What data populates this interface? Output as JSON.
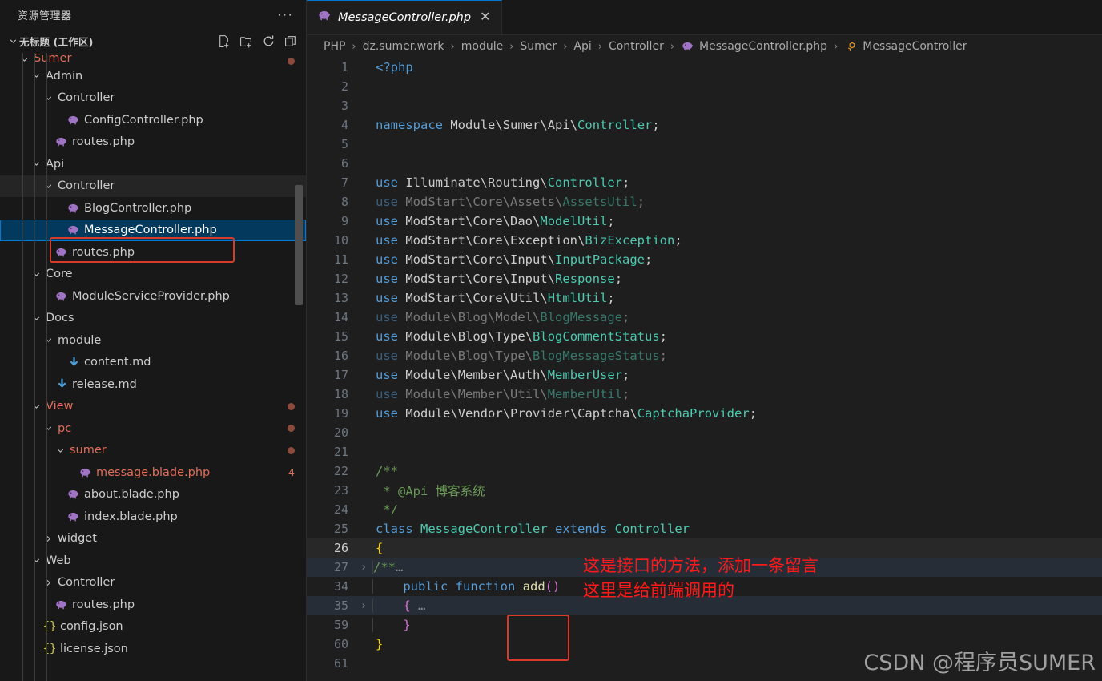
{
  "sidebar": {
    "title": "资源管理器",
    "more_label": "···",
    "workspace": "无标题 (工作区)",
    "actions": [
      {
        "name": "new-file-icon",
        "label": "新建文件"
      },
      {
        "name": "new-folder-icon",
        "label": "新建文件夹"
      },
      {
        "name": "refresh-icon",
        "label": "刷新资源管理器"
      },
      {
        "name": "collapse-all-icon",
        "label": "在资源管理器中折叠文件夹"
      }
    ],
    "tree": [
      {
        "label": "Sumer",
        "type": "folder",
        "depth": 2,
        "expanded": true,
        "color": "modred",
        "dot": true,
        "clipped": false
      },
      {
        "label": "Admin",
        "type": "folder",
        "depth": 3,
        "expanded": true,
        "color": "",
        "dot": false
      },
      {
        "label": "Controller",
        "type": "folder",
        "depth": 4,
        "expanded": true,
        "color": "",
        "dot": false
      },
      {
        "label": "ConfigController.php",
        "type": "php",
        "depth": 5,
        "color": "",
        "dot": false
      },
      {
        "label": "routes.php",
        "type": "php",
        "depth": 4,
        "color": "",
        "dot": false
      },
      {
        "label": "Api",
        "type": "folder",
        "depth": 3,
        "expanded": true,
        "color": "",
        "dot": false
      },
      {
        "label": "Controller",
        "type": "folder",
        "depth": 4,
        "expanded": true,
        "color": "",
        "dot": false,
        "highlighted": true
      },
      {
        "label": "BlogController.php",
        "type": "php",
        "depth": 5,
        "color": "",
        "dot": false
      },
      {
        "label": "MessageController.php",
        "type": "php",
        "depth": 5,
        "color": "",
        "dot": false,
        "selected": true
      },
      {
        "label": "routes.php",
        "type": "php",
        "depth": 4,
        "color": "",
        "dot": false
      },
      {
        "label": "Core",
        "type": "folder",
        "depth": 3,
        "expanded": true,
        "color": "",
        "dot": false
      },
      {
        "label": "ModuleServiceProvider.php",
        "type": "php",
        "depth": 4,
        "color": "",
        "dot": false
      },
      {
        "label": "Docs",
        "type": "folder",
        "depth": 3,
        "expanded": true,
        "color": "",
        "dot": false
      },
      {
        "label": "module",
        "type": "folder",
        "depth": 4,
        "expanded": true,
        "color": "",
        "dot": false
      },
      {
        "label": "content.md",
        "type": "md",
        "depth": 5,
        "color": "",
        "dot": false
      },
      {
        "label": "release.md",
        "type": "md",
        "depth": 4,
        "color": "",
        "dot": false
      },
      {
        "label": "View",
        "type": "folder",
        "depth": 3,
        "expanded": true,
        "color": "modred",
        "dot": true
      },
      {
        "label": "pc",
        "type": "folder",
        "depth": 4,
        "expanded": true,
        "color": "modred",
        "dot": true
      },
      {
        "label": "sumer",
        "type": "folder",
        "depth": 5,
        "expanded": true,
        "color": "modred",
        "dot": true
      },
      {
        "label": "message.blade.php",
        "type": "php",
        "depth": 6,
        "color": "modred",
        "badge": "4"
      },
      {
        "label": "about.blade.php",
        "type": "php",
        "depth": 5,
        "color": "",
        "dot": false
      },
      {
        "label": "index.blade.php",
        "type": "php",
        "depth": 5,
        "color": "",
        "dot": false
      },
      {
        "label": "widget",
        "type": "folder",
        "depth": 4,
        "expanded": false,
        "color": "",
        "dot": false
      },
      {
        "label": "Web",
        "type": "folder",
        "depth": 3,
        "expanded": true,
        "color": "",
        "dot": false
      },
      {
        "label": "Controller",
        "type": "folder",
        "depth": 4,
        "expanded": false,
        "color": "",
        "dot": false
      },
      {
        "label": "routes.php",
        "type": "php",
        "depth": 4,
        "color": "",
        "dot": false
      },
      {
        "label": "config.json",
        "type": "json",
        "depth": 3,
        "color": "",
        "dot": false
      },
      {
        "label": "license.json",
        "type": "json",
        "depth": 3,
        "color": "",
        "dot": false
      }
    ]
  },
  "editor": {
    "tab": {
      "label": "MessageController.php",
      "close": "✕",
      "icon": "php-elephant-icon"
    },
    "breadcrumb": [
      {
        "label": "PHP",
        "icon": ""
      },
      {
        "label": "dz.sumer.work",
        "icon": ""
      },
      {
        "label": "module",
        "icon": ""
      },
      {
        "label": "Sumer",
        "icon": ""
      },
      {
        "label": "Api",
        "icon": ""
      },
      {
        "label": "Controller",
        "icon": ""
      },
      {
        "label": "MessageController.php",
        "icon": "php-elephant-icon"
      },
      {
        "label": "MessageController",
        "icon": "class-symbol-icon"
      }
    ],
    "separator": "›",
    "code": [
      {
        "n": "1",
        "fold": "",
        "state": ""
      },
      {
        "n": "2",
        "fold": "",
        "state": ""
      },
      {
        "n": "3",
        "fold": "",
        "state": ""
      },
      {
        "n": "4",
        "fold": "",
        "state": ""
      },
      {
        "n": "5",
        "fold": "",
        "state": ""
      },
      {
        "n": "6",
        "fold": "",
        "state": ""
      },
      {
        "n": "7",
        "fold": "",
        "state": ""
      },
      {
        "n": "8",
        "fold": "",
        "state": ""
      },
      {
        "n": "9",
        "fold": "",
        "state": ""
      },
      {
        "n": "10",
        "fold": "",
        "state": ""
      },
      {
        "n": "11",
        "fold": "",
        "state": ""
      },
      {
        "n": "12",
        "fold": "",
        "state": ""
      },
      {
        "n": "13",
        "fold": "",
        "state": ""
      },
      {
        "n": "14",
        "fold": "",
        "state": ""
      },
      {
        "n": "15",
        "fold": "",
        "state": ""
      },
      {
        "n": "16",
        "fold": "",
        "state": ""
      },
      {
        "n": "17",
        "fold": "",
        "state": ""
      },
      {
        "n": "18",
        "fold": "",
        "state": ""
      },
      {
        "n": "19",
        "fold": "",
        "state": ""
      },
      {
        "n": "20",
        "fold": "",
        "state": ""
      },
      {
        "n": "21",
        "fold": "",
        "state": ""
      },
      {
        "n": "22",
        "fold": "",
        "state": ""
      },
      {
        "n": "23",
        "fold": "",
        "state": ""
      },
      {
        "n": "24",
        "fold": "",
        "state": ""
      },
      {
        "n": "25",
        "fold": "",
        "state": ""
      },
      {
        "n": "26",
        "fold": "",
        "state": "current"
      },
      {
        "n": "27",
        "fold": "›",
        "state": "folded"
      },
      {
        "n": "34",
        "fold": "",
        "state": ""
      },
      {
        "n": "35",
        "fold": "›",
        "state": "folded"
      },
      {
        "n": "59",
        "fold": "",
        "state": ""
      },
      {
        "n": "60",
        "fold": "",
        "state": ""
      },
      {
        "n": "61",
        "fold": "",
        "state": ""
      }
    ],
    "code_text": [
      "<?php",
      "",
      "",
      "namespace Module\\Sumer\\Api\\Controller;",
      "",
      "",
      "use Illuminate\\Routing\\Controller;",
      "use ModStart\\Core\\Assets\\AssetsUtil;",
      "use ModStart\\Core\\Dao\\ModelUtil;",
      "use ModStart\\Core\\Exception\\BizException;",
      "use ModStart\\Core\\Input\\InputPackage;",
      "use ModStart\\Core\\Input\\Response;",
      "use ModStart\\Core\\Util\\HtmlUtil;",
      "use Module\\Blog\\Model\\BlogMessage;",
      "use Module\\Blog\\Type\\BlogCommentStatus;",
      "use Module\\Blog\\Type\\BlogMessageStatus;",
      "use Module\\Member\\Auth\\MemberUser;",
      "use Module\\Member\\Util\\MemberUtil;",
      "use Module\\Vendor\\Provider\\Captcha\\CaptchaProvider;",
      "",
      "",
      "/**",
      " * @Api 博客系统",
      " */",
      "class MessageController extends Controller",
      "{",
      "    /** …",
      "    public function add()",
      "    { …",
      "    }",
      "}",
      ""
    ],
    "annotations": [
      {
        "text": "这是接口的方法，添加一条留言",
        "color": "#ff1a1a"
      },
      {
        "text": "这里是给前端调用的",
        "color": "#ff1a1a"
      }
    ],
    "highlight_box_label": "add()",
    "watermark": "CSDN @程序员SUMER"
  },
  "colors": {
    "selection_blue": "#04395e",
    "selection_border": "#0078d4",
    "annotation_red": "#d83b2a",
    "annotation_text_red": "#ff1a1a",
    "modified_orange": "#e06c5a",
    "tab_active_border": "#0078d4"
  }
}
